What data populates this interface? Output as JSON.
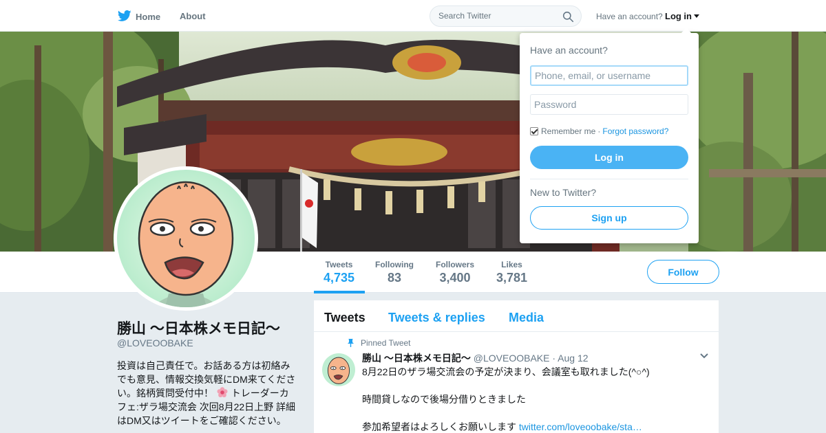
{
  "nav": {
    "home_label": "Home",
    "about_label": "About",
    "search_placeholder": "Search Twitter",
    "have_account": "Have an account?",
    "login_label": "Log in"
  },
  "profile": {
    "name": "勝山 〜日本株メモ日記〜",
    "handle": "@LOVEOOBAKE",
    "bio_line1": "投資は自己責任で。お話ある方は初絡みでも意見、情報交換気軽にDM来てください。銘柄質問受付中！",
    "bio_line2": "トレーダーカフェ:ザラ場交流会 次回8月22日上野 詳細はDM又はツイートをご確認ください。",
    "follow_label": "Follow"
  },
  "stats": [
    {
      "label": "Tweets",
      "value": "4,735"
    },
    {
      "label": "Following",
      "value": "83"
    },
    {
      "label": "Followers",
      "value": "3,400"
    },
    {
      "label": "Likes",
      "value": "3,781"
    }
  ],
  "timeline": {
    "tabs": [
      "Tweets",
      "Tweets & replies",
      "Media"
    ]
  },
  "tweet": {
    "pinned_label": "Pinned Tweet",
    "name": "勝山 〜日本株メモ日記〜",
    "handle": "@LOVEOOBAKE",
    "separator": "·",
    "date": "Aug 12",
    "line1": "8月22日のザラ場交流会の予定が決まり、会議室も取れました(^○^)",
    "line2": "時間貸しなので後場分借りときました",
    "line3": "参加希望者はよろしくお願いします",
    "link": "twitter.com/loveoobake/sta…"
  },
  "login_dropdown": {
    "title": "Have an account?",
    "username_placeholder": "Phone, email, or username",
    "password_placeholder": "Password",
    "remember_label": "Remember me",
    "separator": "·",
    "forgot_label": "Forgot password?",
    "login_button": "Log in",
    "new_label": "New to Twitter?",
    "signup_button": "Sign up"
  },
  "colors": {
    "accent": "#1da1f2",
    "login_button": "#4ab3f4",
    "background": "#e6ecf0"
  },
  "icons": [
    "twitter-bird-icon",
    "search-icon",
    "caret-down-icon",
    "pin-icon",
    "chevron-down-icon",
    "flower-emoji-icon",
    "checkbox-icon"
  ]
}
